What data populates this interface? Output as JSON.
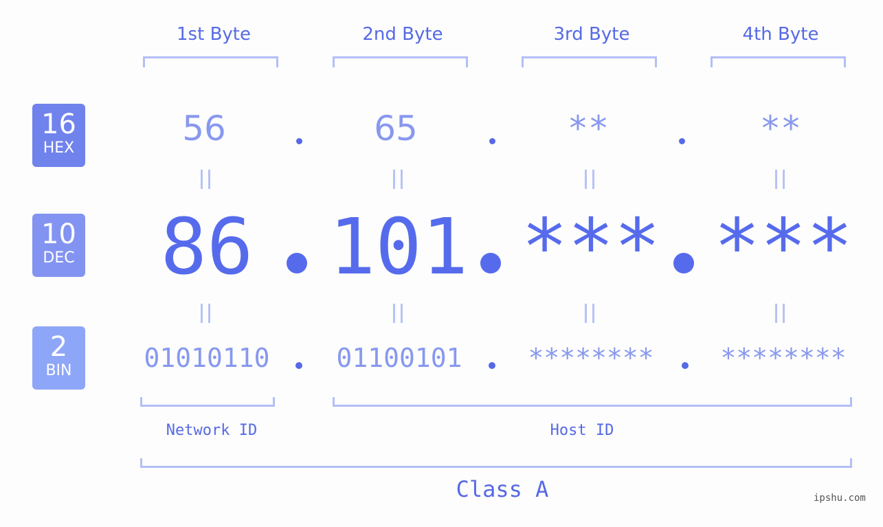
{
  "badges": [
    {
      "number": "16",
      "label": "HEX"
    },
    {
      "number": "10",
      "label": "DEC"
    },
    {
      "number": "2",
      "label": "BIN"
    }
  ],
  "byte_headers": [
    "1st Byte",
    "2nd Byte",
    "3rd Byte",
    "4th Byte"
  ],
  "hex": [
    "56",
    "65",
    "**",
    "**"
  ],
  "dec": [
    "86",
    "101",
    "***",
    "***"
  ],
  "bin": [
    "01010110",
    "01100101",
    "********",
    "********"
  ],
  "network_id_label": "Network ID",
  "host_id_label": "Host ID",
  "class_label": "Class A",
  "watermark": "ipshu.com",
  "colors": {
    "accent": "#566bec",
    "light_accent": "#8898ef",
    "bracket": "#b3bef7",
    "hex_badge": "#7082ec",
    "dec_badge": "#8393f1",
    "bin_badge": "#8ea6f8"
  }
}
